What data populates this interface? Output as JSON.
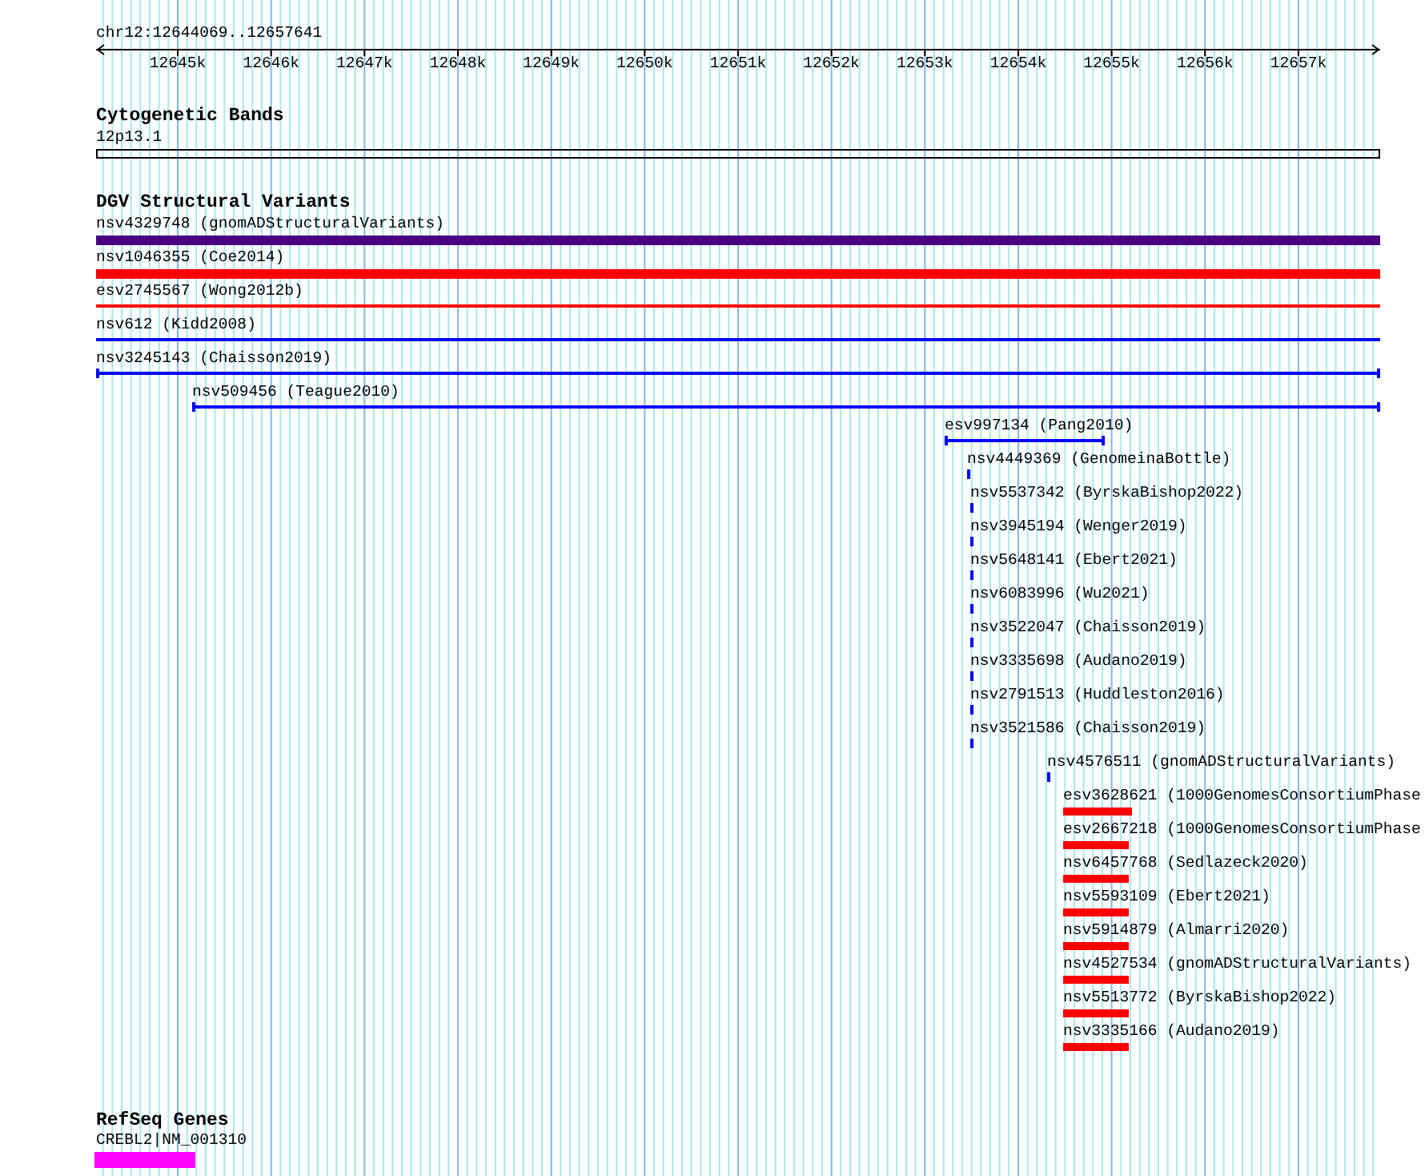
{
  "ruler": {
    "location": "chr12:12644069..12657641",
    "ticks": [
      "12645k",
      "12646k",
      "12647k",
      "12648k",
      "12649k",
      "12650k",
      "12651k",
      "12652k",
      "12653k",
      "12654k",
      "12655k",
      "12656k",
      "12657k"
    ]
  },
  "tracks": [
    {
      "title": "Cytogenetic Bands",
      "features": [
        {
          "label": "12p13.1",
          "kind": "band",
          "color": "#000000"
        }
      ]
    },
    {
      "title": "DGV Structural Variants",
      "features": [
        {
          "label": "nsv4329748 (gnomADStructuralVariants)",
          "kind": "thick",
          "color": "#4b0082"
        },
        {
          "label": "nsv1046355 (Coe2014)",
          "kind": "thick",
          "color": "#ff0000"
        },
        {
          "label": "esv2745567 (Wong2012b)",
          "kind": "line",
          "color": "#ff0000"
        },
        {
          "label": "nsv612 (Kidd2008)",
          "kind": "line",
          "color": "#0000ff"
        },
        {
          "label": "nsv3245143 (Chaisson2019)",
          "kind": "line",
          "color": "#0000ff"
        },
        {
          "label": "nsv509456 (Teague2010)",
          "kind": "line",
          "color": "#0000ff"
        },
        {
          "label": "esv997134 (Pang2010)",
          "kind": "line",
          "color": "#0000ff"
        },
        {
          "label": "nsv4449369 (GenomeinaBottle)",
          "kind": "mark",
          "color": "#0000ff"
        },
        {
          "label": "nsv5537342 (ByrskaBishop2022)",
          "kind": "mark",
          "color": "#0000ff"
        },
        {
          "label": "nsv3945194 (Wenger2019)",
          "kind": "mark",
          "color": "#0000ff"
        },
        {
          "label": "nsv5648141 (Ebert2021)",
          "kind": "mark",
          "color": "#0000ff"
        },
        {
          "label": "nsv6083996 (Wu2021)",
          "kind": "mark",
          "color": "#0000ff"
        },
        {
          "label": "nsv3522047 (Chaisson2019)",
          "kind": "mark",
          "color": "#0000ff"
        },
        {
          "label": "nsv3335698 (Audano2019)",
          "kind": "mark",
          "color": "#0000ff"
        },
        {
          "label": "nsv2791513 (Huddleston2016)",
          "kind": "mark",
          "color": "#0000ff"
        },
        {
          "label": "nsv3521586 (Chaisson2019)",
          "kind": "mark",
          "color": "#0000ff"
        },
        {
          "label": "nsv4576511 (gnomADStructuralVariants)",
          "kind": "mark",
          "color": "#0000ff"
        },
        {
          "label": "esv3628621 (1000GenomesConsortiumPhase",
          "kind": "thick",
          "color": "#ff0000"
        },
        {
          "label": "esv2667218 (1000GenomesConsortiumPhase",
          "kind": "thick",
          "color": "#ff0000"
        },
        {
          "label": "nsv6457768 (Sedlazeck2020)",
          "kind": "thick",
          "color": "#ff0000"
        },
        {
          "label": "nsv5593109 (Ebert2021)",
          "kind": "thick",
          "color": "#ff0000"
        },
        {
          "label": "nsv5914879 (Almarri2020)",
          "kind": "thick",
          "color": "#ff0000"
        },
        {
          "label": "nsv4527534 (gnomADStructuralVariants)",
          "kind": "thick",
          "color": "#ff0000"
        },
        {
          "label": "nsv5513772 (ByrskaBishop2022)",
          "kind": "thick",
          "color": "#ff0000"
        },
        {
          "label": "nsv3335166 (Audano2019)",
          "kind": "thick",
          "color": "#ff0000"
        }
      ]
    },
    {
      "title": "RefSeq Genes",
      "features": [
        {
          "label": "CREBL2|NM_001310",
          "kind": "thick",
          "color": "#ff00ff"
        }
      ]
    }
  ]
}
